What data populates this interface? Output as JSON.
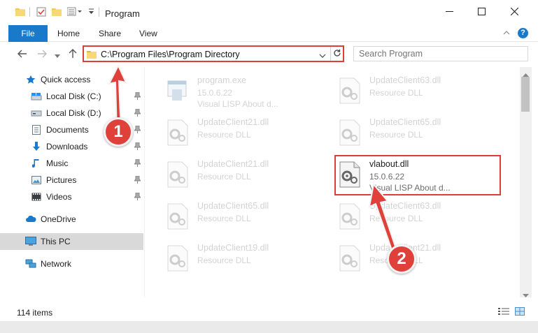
{
  "window": {
    "title": "Program",
    "minimize_icon": "minimize-icon",
    "maximize_icon": "maximize-icon",
    "close_icon": "close-icon"
  },
  "ribbon": {
    "tabs": [
      {
        "label": "File"
      },
      {
        "label": "Home"
      },
      {
        "label": "Share"
      },
      {
        "label": "View"
      }
    ],
    "help": "?"
  },
  "address": {
    "path": "C:\\Program Files\\Program Directory"
  },
  "search": {
    "placeholder": "Search Program"
  },
  "nav": {
    "items": [
      {
        "label": "Quick access",
        "icon": "star-icon"
      },
      {
        "label": "Local Disk (C:)",
        "icon": "drive-icon"
      },
      {
        "label": "Local Disk (D:)",
        "icon": "drive-icon"
      },
      {
        "label": "Documents",
        "icon": "documents-icon"
      },
      {
        "label": "Downloads",
        "icon": "download-icon"
      },
      {
        "label": "Music",
        "icon": "music-icon"
      },
      {
        "label": "Pictures",
        "icon": "pictures-icon"
      },
      {
        "label": "Videos",
        "icon": "videos-icon"
      },
      {
        "label": "OneDrive",
        "icon": "cloud-icon"
      },
      {
        "label": "This PC",
        "icon": "computer-icon"
      },
      {
        "label": "Network",
        "icon": "network-icon"
      }
    ]
  },
  "files": [
    {
      "name": "program.exe",
      "sub": "15.0.6.22",
      "sub2": "Visual LISP About d..."
    },
    {
      "name": "UpdateClient63.dll",
      "sub": "Resource DLL",
      "sub2": ""
    },
    {
      "name": "UpdateClient21.dll",
      "sub": "Resource DLL",
      "sub2": ""
    },
    {
      "name": "UpdateClient65.dll",
      "sub": "Resource DLL",
      "sub2": ""
    },
    {
      "name": "UpdateClient21.dll",
      "sub": "Resource DLL",
      "sub2": ""
    },
    {
      "name": "vlabout.dll",
      "sub": "15.0.6.22",
      "sub2": "Visual LISP About d..."
    },
    {
      "name": "UpdateClient65.dll",
      "sub": "Resource DLL",
      "sub2": ""
    },
    {
      "name": "UpdateClient63.dll",
      "sub": "Resource DLL",
      "sub2": ""
    },
    {
      "name": "UpdateClient19.dll",
      "sub": "Resource DLL",
      "sub2": ""
    },
    {
      "name": "UpdateClient21.dll",
      "sub": "Resource DLL",
      "sub2": ""
    }
  ],
  "status": {
    "items_count": "114 items"
  },
  "callouts": [
    {
      "label": "1"
    },
    {
      "label": "2"
    }
  ],
  "colors": {
    "accent": "#1979ca",
    "callout": "#e0403a"
  }
}
